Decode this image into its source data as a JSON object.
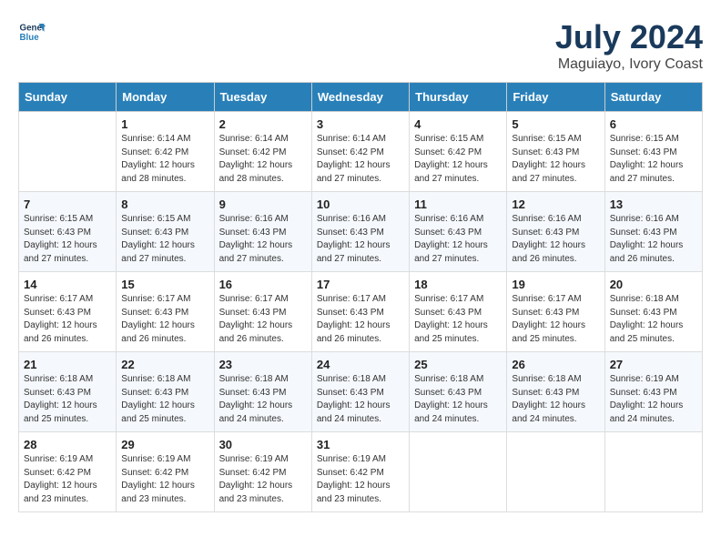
{
  "header": {
    "logo_line1": "General",
    "logo_line2": "Blue",
    "month_title": "July 2024",
    "location": "Maguiayo, Ivory Coast"
  },
  "days_of_week": [
    "Sunday",
    "Monday",
    "Tuesday",
    "Wednesday",
    "Thursday",
    "Friday",
    "Saturday"
  ],
  "weeks": [
    [
      {
        "day": "",
        "info": ""
      },
      {
        "day": "1",
        "info": "Sunrise: 6:14 AM\nSunset: 6:42 PM\nDaylight: 12 hours\nand 28 minutes."
      },
      {
        "day": "2",
        "info": "Sunrise: 6:14 AM\nSunset: 6:42 PM\nDaylight: 12 hours\nand 28 minutes."
      },
      {
        "day": "3",
        "info": "Sunrise: 6:14 AM\nSunset: 6:42 PM\nDaylight: 12 hours\nand 27 minutes."
      },
      {
        "day": "4",
        "info": "Sunrise: 6:15 AM\nSunset: 6:42 PM\nDaylight: 12 hours\nand 27 minutes."
      },
      {
        "day": "5",
        "info": "Sunrise: 6:15 AM\nSunset: 6:43 PM\nDaylight: 12 hours\nand 27 minutes."
      },
      {
        "day": "6",
        "info": "Sunrise: 6:15 AM\nSunset: 6:43 PM\nDaylight: 12 hours\nand 27 minutes."
      }
    ],
    [
      {
        "day": "7",
        "info": ""
      },
      {
        "day": "8",
        "info": "Sunrise: 6:15 AM\nSunset: 6:43 PM\nDaylight: 12 hours\nand 27 minutes."
      },
      {
        "day": "9",
        "info": "Sunrise: 6:16 AM\nSunset: 6:43 PM\nDaylight: 12 hours\nand 27 minutes."
      },
      {
        "day": "10",
        "info": "Sunrise: 6:16 AM\nSunset: 6:43 PM\nDaylight: 12 hours\nand 27 minutes."
      },
      {
        "day": "11",
        "info": "Sunrise: 6:16 AM\nSunset: 6:43 PM\nDaylight: 12 hours\nand 27 minutes."
      },
      {
        "day": "12",
        "info": "Sunrise: 6:16 AM\nSunset: 6:43 PM\nDaylight: 12 hours\nand 26 minutes."
      },
      {
        "day": "13",
        "info": "Sunrise: 6:16 AM\nSunset: 6:43 PM\nDaylight: 12 hours\nand 26 minutes."
      }
    ],
    [
      {
        "day": "14",
        "info": ""
      },
      {
        "day": "15",
        "info": "Sunrise: 6:17 AM\nSunset: 6:43 PM\nDaylight: 12 hours\nand 26 minutes."
      },
      {
        "day": "16",
        "info": "Sunrise: 6:17 AM\nSunset: 6:43 PM\nDaylight: 12 hours\nand 26 minutes."
      },
      {
        "day": "17",
        "info": "Sunrise: 6:17 AM\nSunset: 6:43 PM\nDaylight: 12 hours\nand 26 minutes."
      },
      {
        "day": "18",
        "info": "Sunrise: 6:17 AM\nSunset: 6:43 PM\nDaylight: 12 hours\nand 25 minutes."
      },
      {
        "day": "19",
        "info": "Sunrise: 6:17 AM\nSunset: 6:43 PM\nDaylight: 12 hours\nand 25 minutes."
      },
      {
        "day": "20",
        "info": "Sunrise: 6:18 AM\nSunset: 6:43 PM\nDaylight: 12 hours\nand 25 minutes."
      }
    ],
    [
      {
        "day": "21",
        "info": ""
      },
      {
        "day": "22",
        "info": "Sunrise: 6:18 AM\nSunset: 6:43 PM\nDaylight: 12 hours\nand 25 minutes."
      },
      {
        "day": "23",
        "info": "Sunrise: 6:18 AM\nSunset: 6:43 PM\nDaylight: 12 hours\nand 24 minutes."
      },
      {
        "day": "24",
        "info": "Sunrise: 6:18 AM\nSunset: 6:43 PM\nDaylight: 12 hours\nand 24 minutes."
      },
      {
        "day": "25",
        "info": "Sunrise: 6:18 AM\nSunset: 6:43 PM\nDaylight: 12 hours\nand 24 minutes."
      },
      {
        "day": "26",
        "info": "Sunrise: 6:18 AM\nSunset: 6:43 PM\nDaylight: 12 hours\nand 24 minutes."
      },
      {
        "day": "27",
        "info": "Sunrise: 6:19 AM\nSunset: 6:43 PM\nDaylight: 12 hours\nand 24 minutes."
      }
    ],
    [
      {
        "day": "28",
        "info": "Sunrise: 6:19 AM\nSunset: 6:42 PM\nDaylight: 12 hours\nand 23 minutes."
      },
      {
        "day": "29",
        "info": "Sunrise: 6:19 AM\nSunset: 6:42 PM\nDaylight: 12 hours\nand 23 minutes."
      },
      {
        "day": "30",
        "info": "Sunrise: 6:19 AM\nSunset: 6:42 PM\nDaylight: 12 hours\nand 23 minutes."
      },
      {
        "day": "31",
        "info": "Sunrise: 6:19 AM\nSunset: 6:42 PM\nDaylight: 12 hours\nand 23 minutes."
      },
      {
        "day": "",
        "info": ""
      },
      {
        "day": "",
        "info": ""
      },
      {
        "day": "",
        "info": ""
      }
    ]
  ]
}
